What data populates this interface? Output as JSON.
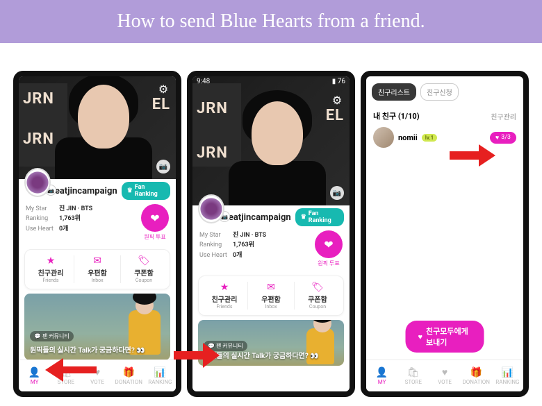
{
  "title": "How to send Blue Hearts from a friend.",
  "hero_sign_left_top": "JRN",
  "hero_sign_left_bottom": "JRN",
  "hero_sign_right": "EL",
  "status_time": "9:48",
  "profile": {
    "username": "eatjincampaign",
    "fan_badge": "Fan Ranking",
    "stats": {
      "mystar_k": "My Star",
      "mystar_v": "진 JIN · BTS",
      "ranking_k": "Ranking",
      "ranking_v": "1,763위",
      "useheart_k": "Use Heart",
      "useheart_v": "0개"
    },
    "pink_caption": "원픽 투표"
  },
  "actions": {
    "friends_lab": "친구관리",
    "friends_sub": "Friends",
    "inbox_lab": "우편함",
    "inbox_sub": "Inbox",
    "coupon_lab": "쿠폰함",
    "coupon_sub": "Coupon"
  },
  "banner": {
    "tag": "💬 팬 커뮤니티",
    "text": "원픽들의 실시간 Talk가 궁금하다면? 👀"
  },
  "nav": {
    "my": "MY",
    "store": "STORE",
    "vote": "VOTE",
    "donation": "DONATION",
    "ranking": "RANKING"
  },
  "s3": {
    "tab_list": "친구리스트",
    "tab_apply": "친구신청",
    "header": "내 친구 (1/10)",
    "manage": "친구관리",
    "friend_name": "nomii",
    "friend_level": "lv.1",
    "heart_count": "3/3",
    "send_all": "친구모두에게 보내기"
  }
}
